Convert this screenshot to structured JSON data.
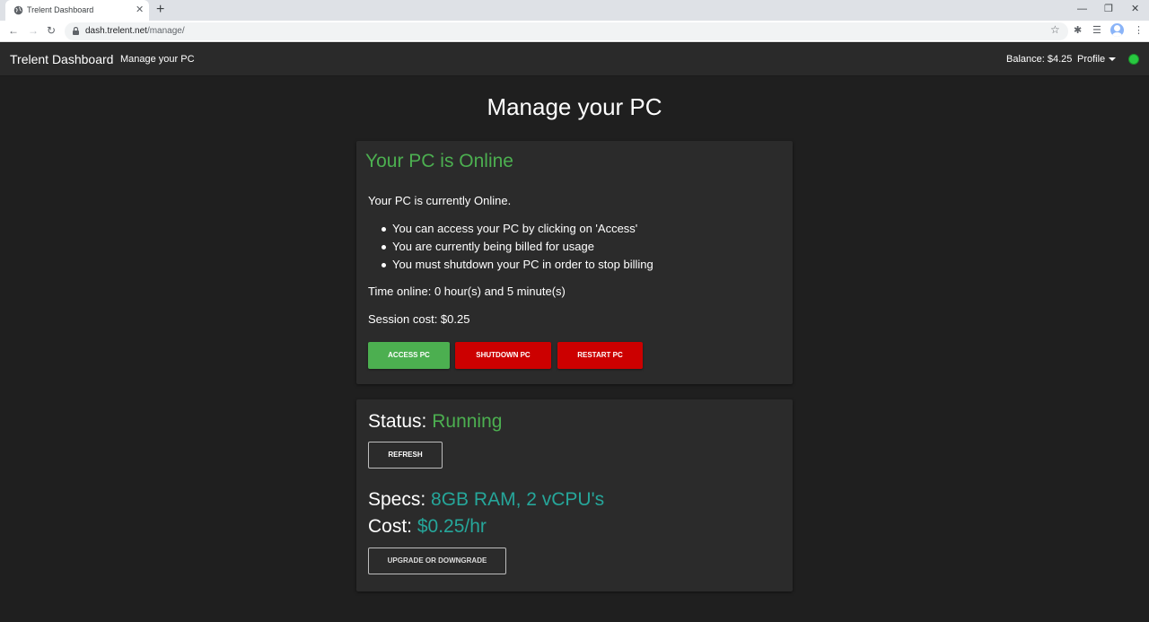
{
  "browser": {
    "tab_title": "Trelent Dashboard",
    "url_host": "dash.trelent.net",
    "url_path": "/manage/"
  },
  "navbar": {
    "brand": "Trelent Dashboard",
    "link": "Manage your PC",
    "balance": "Balance: $4.25",
    "profile": "Profile"
  },
  "page": {
    "title": "Manage your PC"
  },
  "pc_card": {
    "heading": "Your PC is Online",
    "status_text": "Your PC is currently Online.",
    "bullets": [
      "You can access your PC by clicking on 'Access'",
      "You are currently being billed for usage",
      "You must shutdown your PC in order to stop billing"
    ],
    "time_online": "Time online: 0 hour(s) and 5 minute(s)",
    "session_cost": "Session cost: $0.25",
    "buttons": {
      "access": "ACCESS PC",
      "shutdown": "SHUTDOWN PC",
      "restart": "RESTART PC"
    }
  },
  "status_card": {
    "status_label": "Status:",
    "status_value": "Running",
    "refresh": "REFRESH",
    "specs_label": "Specs:",
    "specs_value": "8GB RAM, 2 vCPU's",
    "cost_label": "Cost:",
    "cost_value": "$0.25/hr",
    "upgrade": "UPGRADE OR DOWNGRADE"
  },
  "colors": {
    "online_green": "#4caf50",
    "danger_red": "#cc0000",
    "accent_teal": "#26a69a",
    "status_dot": "#28c840"
  }
}
